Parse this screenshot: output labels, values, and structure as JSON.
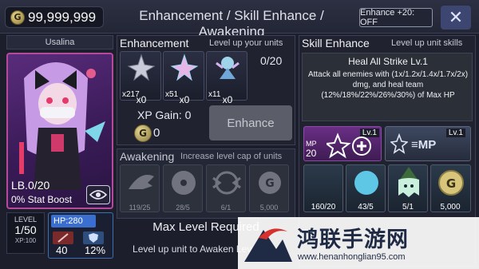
{
  "topbar": {
    "gold": "99,999,999",
    "coin_letter": "G",
    "title": "Enhancement / Skill Enhance / Awakening",
    "enhance20": "Enhance +20: OFF",
    "close": "✕"
  },
  "unit": {
    "name": "Usalina",
    "lb": "LB.0/20",
    "stat_boost": "0% Stat Boost",
    "level_label": "LEVEL",
    "level": "1/50",
    "xp": "XP:100",
    "hp": "HP:280",
    "atk": "40",
    "def": "12%"
  },
  "enhancement": {
    "title": "Enhancement",
    "subtitle": "Level up your units",
    "count": "0/20",
    "materials": [
      {
        "count": "x217",
        "selected": "x0",
        "icon": "silver-star-icon"
      },
      {
        "count": "x51",
        "selected": "x0",
        "icon": "rainbow-star-icon"
      },
      {
        "count": "x11",
        "selected": "x0",
        "icon": "fairy-icon"
      }
    ],
    "xp_gain_label": "XP Gain: 0",
    "cost": "0",
    "button": "Enhance"
  },
  "awakening": {
    "title": "Awakening",
    "subtitle": "Increase level cap of units",
    "items": [
      {
        "count": "119/25",
        "icon": "wing-icon"
      },
      {
        "count": "28/5",
        "icon": "disc-icon"
      },
      {
        "count": "6/1",
        "icon": "emblem-icon"
      },
      {
        "count": "5,000",
        "icon": "gold-coin-icon"
      }
    ],
    "max_level": "Max Level Required",
    "max_sub": "Level up unit to Awaken Level Cap"
  },
  "skill": {
    "title": "Skill Enhance",
    "subtitle": "Level up unit skills",
    "skill_name": "Heal All Strike Lv.1",
    "skill_desc": "Attack all enemies with (1x/1.2x/1.4x/1.7x/2x) dmg, and heal team (12%/18%/22%/26%/30%) of Max HP",
    "cards": [
      {
        "lv": "Lv.1",
        "mp_label": "MP",
        "mp_value": "20"
      },
      {
        "lv": "Lv.1",
        "text": "≡MP"
      }
    ],
    "resources": [
      {
        "count": "160/20",
        "icon": "crescent-icon"
      },
      {
        "count": "43/5",
        "icon": "moon-orb-icon"
      },
      {
        "count": "5/1",
        "icon": "witch-ghost-icon"
      },
      {
        "count": "5,000",
        "icon": "gold-coin-icon"
      }
    ]
  },
  "watermark": {
    "text": "鸿联手游网",
    "url": "www.henanhonglian95.com"
  }
}
